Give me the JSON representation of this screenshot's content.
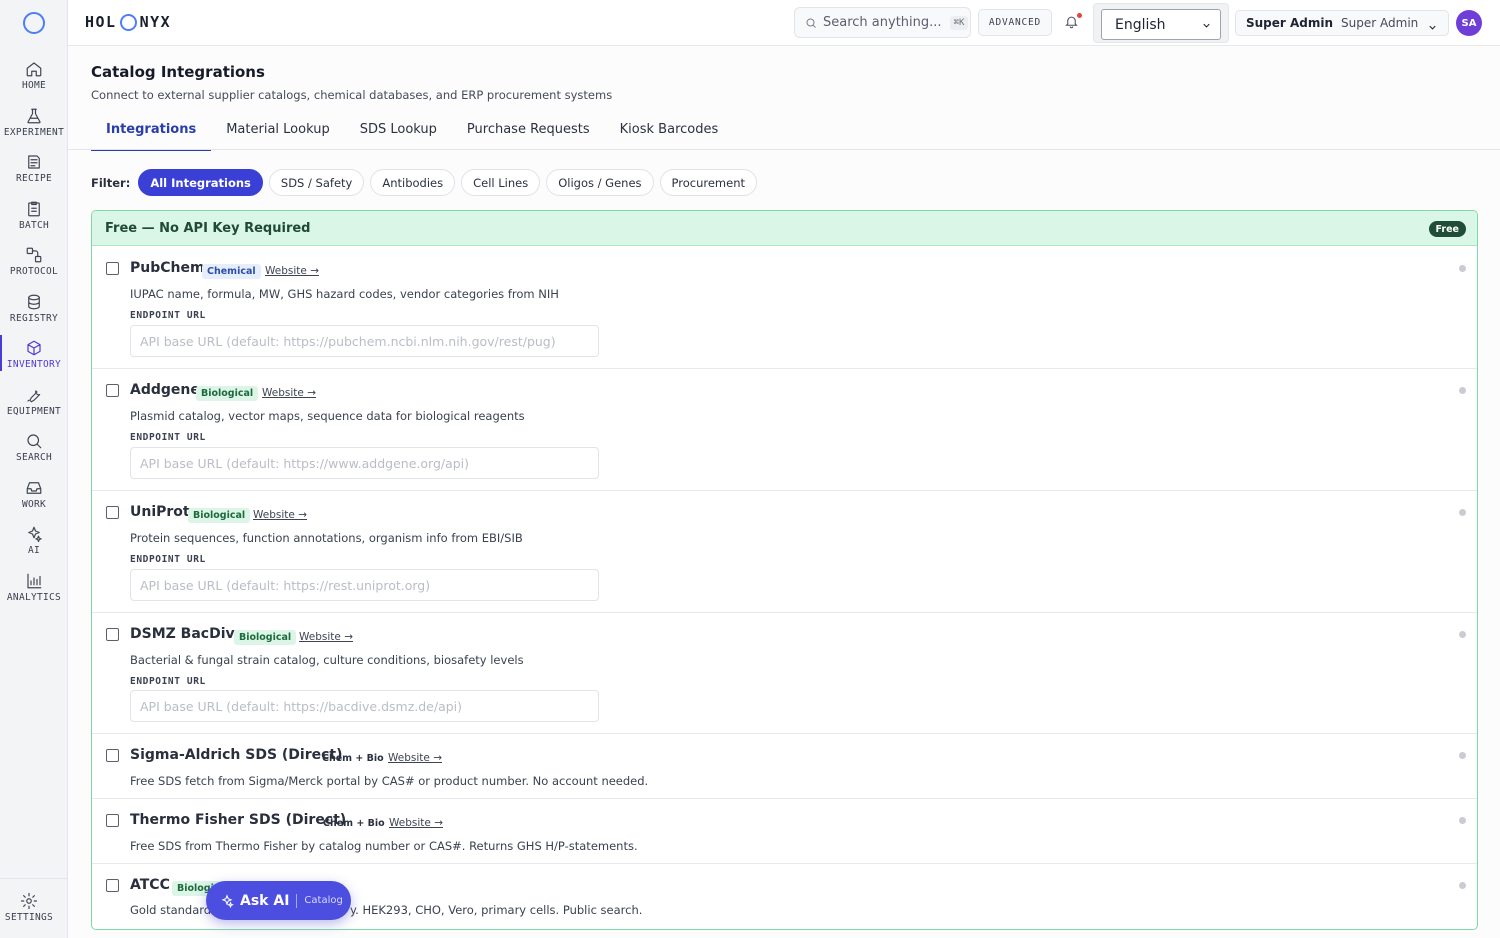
{
  "sidebar": {
    "items": [
      {
        "label": "HOME",
        "icon": "home-icon"
      },
      {
        "label": "EXPERIMENT",
        "icon": "flask-icon"
      },
      {
        "label": "RECIPE",
        "icon": "recipe-icon"
      },
      {
        "label": "BATCH",
        "icon": "clipboard-icon"
      },
      {
        "label": "PROTOCOL",
        "icon": "protocol-icon"
      },
      {
        "label": "REGISTRY",
        "icon": "database-icon"
      },
      {
        "label": "INVENTORY",
        "icon": "box-icon",
        "active": true
      },
      {
        "label": "EQUIPMENT",
        "icon": "wrench-icon"
      },
      {
        "label": "SEARCH",
        "icon": "search-icon"
      },
      {
        "label": "WORK",
        "icon": "inbox-icon"
      },
      {
        "label": "AI",
        "icon": "sparkle-icon"
      },
      {
        "label": "ANALYTICS",
        "icon": "bar-chart-icon"
      }
    ],
    "settings_label": "SETTINGS"
  },
  "topbar": {
    "brand_left": "HOL",
    "brand_right": "NYX",
    "search_placeholder": "Search anything...",
    "search_shortcut": "⌘K",
    "advanced_label": "ADVANCED",
    "language": "English",
    "user_name": "Super Admin",
    "user_role": "Super Admin",
    "avatar_initials": "SA"
  },
  "page": {
    "title": "Catalog Integrations",
    "subtitle": "Connect to external supplier catalogs, chemical databases, and ERP procurement systems",
    "tabs": [
      {
        "label": "Integrations",
        "active": true
      },
      {
        "label": "Material Lookup"
      },
      {
        "label": "SDS Lookup"
      },
      {
        "label": "Purchase Requests"
      },
      {
        "label": "Kiosk Barcodes"
      }
    ],
    "filter_label": "Filter:",
    "filters": [
      {
        "label": "All Integrations",
        "active": true
      },
      {
        "label": "SDS / Safety"
      },
      {
        "label": "Antibodies"
      },
      {
        "label": "Cell Lines"
      },
      {
        "label": "Oligos / Genes"
      },
      {
        "label": "Procurement"
      }
    ]
  },
  "section": {
    "title": "Free — No API Key Required",
    "badge": "Free",
    "integrations": [
      {
        "name": "PubChem",
        "category": "Chemical",
        "category_kind": "chem",
        "website": "Website →",
        "description": "IUPAC name, formula, MW, GHS hazard codes, vendor categories from NIH",
        "endpoint_label": "ENDPOINT URL",
        "endpoint_placeholder": "API base URL (default: https://pubchem.ncbi.nlm.nih.gov/rest/pug)"
      },
      {
        "name": "Addgene",
        "category": "Biological",
        "category_kind": "bio",
        "website": "Website →",
        "description": "Plasmid catalog, vector maps, sequence data for biological reagents",
        "endpoint_label": "ENDPOINT URL",
        "endpoint_placeholder": "API base URL (default: https://www.addgene.org/api)"
      },
      {
        "name": "UniProt",
        "category": "Biological",
        "category_kind": "bio",
        "website": "Website →",
        "description": "Protein sequences, function annotations, organism info from EBI/SIB",
        "endpoint_label": "ENDPOINT URL",
        "endpoint_placeholder": "API base URL (default: https://rest.uniprot.org)"
      },
      {
        "name": "DSMZ BacDive",
        "category": "Biological",
        "category_kind": "bio",
        "website": "Website →",
        "description": "Bacterial & fungal strain catalog, culture conditions, biosafety levels",
        "endpoint_label": "ENDPOINT URL",
        "endpoint_placeholder": "API base URL (default: https://bacdive.dsmz.de/api)"
      },
      {
        "name": "Sigma-Aldrich SDS (Direct)",
        "category": "Chem + Bio",
        "category_kind": "chembio",
        "website": "Website →",
        "description": "Free SDS fetch from Sigma/Merck portal by CAS# or product number. No account needed."
      },
      {
        "name": "Thermo Fisher SDS (Direct)",
        "category": "Chem + Bio",
        "category_kind": "chembio",
        "website": "Website →",
        "description": "Free SDS from Thermo Fisher by catalog number or CAS#. Returns GHS H/P-statements."
      },
      {
        "name": "ATCC",
        "category": "Biologic",
        "category_kind": "bio",
        "description_start": "Gold standard",
        "description_end": "y. HEK293, CHO, Vero, primary cells. Public search."
      }
    ]
  },
  "ask_ai": {
    "label": "Ask AI",
    "context": "Catalog"
  }
}
